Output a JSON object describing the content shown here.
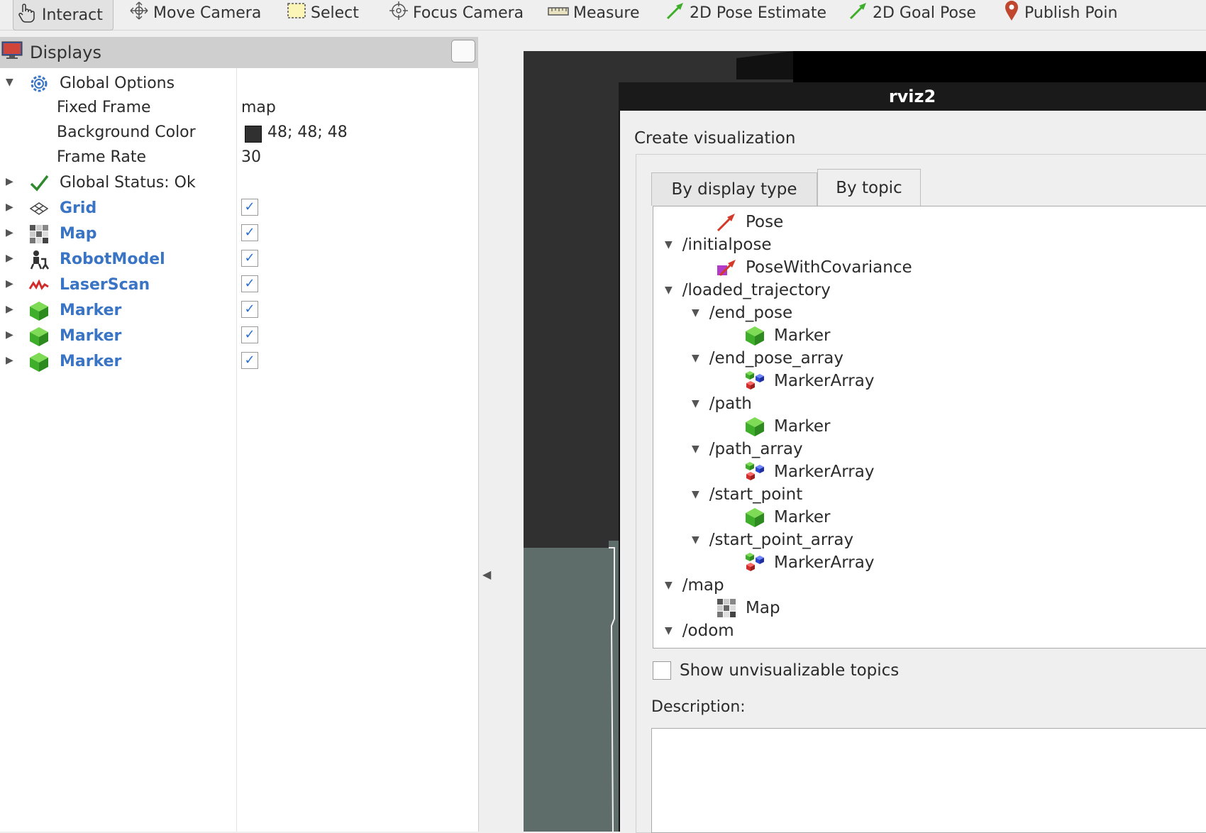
{
  "toolbar": {
    "tools": [
      {
        "label": "Interact",
        "icon": "hand-icon"
      },
      {
        "label": "Move Camera",
        "icon": "move-icon"
      },
      {
        "label": "Select",
        "icon": "select-icon"
      },
      {
        "label": "Focus Camera",
        "icon": "focus-icon"
      },
      {
        "label": "Measure",
        "icon": "ruler-icon"
      },
      {
        "label": "2D Pose Estimate",
        "icon": "green-arrow-icon"
      },
      {
        "label": "2D Goal Pose",
        "icon": "green-arrow-icon"
      },
      {
        "label": "Publish Poin",
        "icon": "pin-icon"
      }
    ]
  },
  "displays": {
    "title": "Displays",
    "global_options": "Global Options",
    "fixed_frame_label": "Fixed Frame",
    "fixed_frame_value": "map",
    "background_color_label": "Background Color",
    "background_color_value": "48; 48; 48",
    "background_color_swatch": "#303030",
    "frame_rate_label": "Frame Rate",
    "frame_rate_value": "30",
    "global_status": "Global Status: Ok",
    "items": [
      {
        "name": "Grid",
        "checked": true
      },
      {
        "name": "Map",
        "checked": true
      },
      {
        "name": "RobotModel",
        "checked": true
      },
      {
        "name": "LaserScan",
        "checked": true
      },
      {
        "name": "Marker",
        "checked": true
      },
      {
        "name": "Marker",
        "checked": true
      },
      {
        "name": "Marker",
        "checked": true
      }
    ],
    "check_glyph": "✓"
  },
  "dialog": {
    "title": "rviz2",
    "heading": "Create visualization",
    "tabs": [
      "By display type",
      "By topic"
    ],
    "active_tab": "By topic",
    "tree": [
      {
        "label": "Pose",
        "level": 2,
        "icon": "pose-arrow-icon"
      },
      {
        "label": "/initialpose",
        "level": 0,
        "expanded": true
      },
      {
        "label": "PoseWithCovariance",
        "level": 2,
        "icon": "pose-covariance-icon"
      },
      {
        "label": "/loaded_trajectory",
        "level": 0,
        "expanded": true
      },
      {
        "label": "/end_pose",
        "level": 1,
        "expanded": true
      },
      {
        "label": "Marker",
        "level": 3,
        "icon": "marker-cube-icon"
      },
      {
        "label": "/end_pose_array",
        "level": 1,
        "expanded": true
      },
      {
        "label": "MarkerArray",
        "level": 3,
        "icon": "marker-array-icon"
      },
      {
        "label": "/path",
        "level": 1,
        "expanded": true
      },
      {
        "label": "Marker",
        "level": 3,
        "icon": "marker-cube-icon"
      },
      {
        "label": "/path_array",
        "level": 1,
        "expanded": true
      },
      {
        "label": "MarkerArray",
        "level": 3,
        "icon": "marker-array-icon"
      },
      {
        "label": "/start_point",
        "level": 1,
        "expanded": true
      },
      {
        "label": "Marker",
        "level": 3,
        "icon": "marker-cube-icon"
      },
      {
        "label": "/start_point_array",
        "level": 1,
        "expanded": true
      },
      {
        "label": "MarkerArray",
        "level": 3,
        "icon": "marker-array-icon"
      },
      {
        "label": "/map",
        "level": 0,
        "expanded": true
      },
      {
        "label": "Map",
        "level": 2,
        "icon": "map-grid-icon"
      },
      {
        "label": "/odom",
        "level": 0,
        "expanded": true
      }
    ],
    "show_unvisualizable": "Show unvisualizable topics",
    "description_label": "Description:"
  },
  "colors": {
    "link_blue": "#3a74c4",
    "marker_green": "#3fae2a"
  }
}
